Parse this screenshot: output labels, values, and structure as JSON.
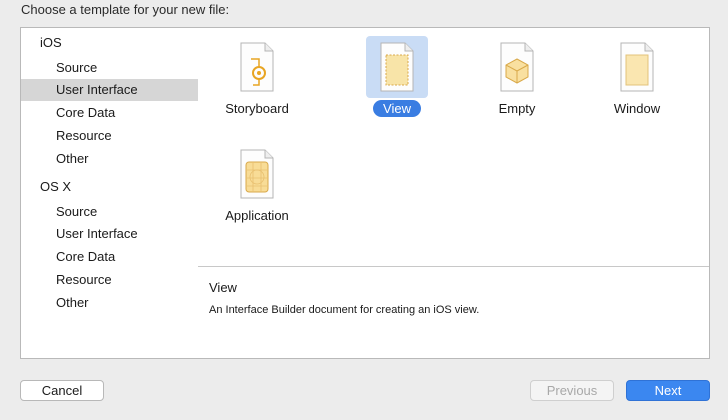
{
  "header": {
    "title": "Choose a template for your new file:"
  },
  "sidebar": {
    "ios": {
      "title": "iOS",
      "items": [
        "Source",
        "User Interface",
        "Core Data",
        "Resource",
        "Other"
      ]
    },
    "osx": {
      "title": "OS X",
      "items": [
        "Source",
        "User Interface",
        "Core Data",
        "Resource",
        "Other"
      ]
    },
    "selected": "iOS / User Interface"
  },
  "templates": [
    {
      "label": "Storyboard",
      "icon": "storyboard-file-icon"
    },
    {
      "label": "View",
      "icon": "view-file-icon",
      "selected": true
    },
    {
      "label": "Empty",
      "icon": "empty-file-icon"
    },
    {
      "label": "Window",
      "icon": "window-file-icon"
    },
    {
      "label": "Application",
      "icon": "application-file-icon"
    }
  ],
  "description": {
    "title": "View",
    "text": "An Interface Builder document for creating an iOS view."
  },
  "buttons": {
    "cancel": "Cancel",
    "previous": "Previous",
    "next": "Next"
  },
  "colors": {
    "selection_blue": "#3a7de2",
    "sidebar_selection": "#d6d6d6",
    "icon_yellow": "#f6dc8e"
  }
}
